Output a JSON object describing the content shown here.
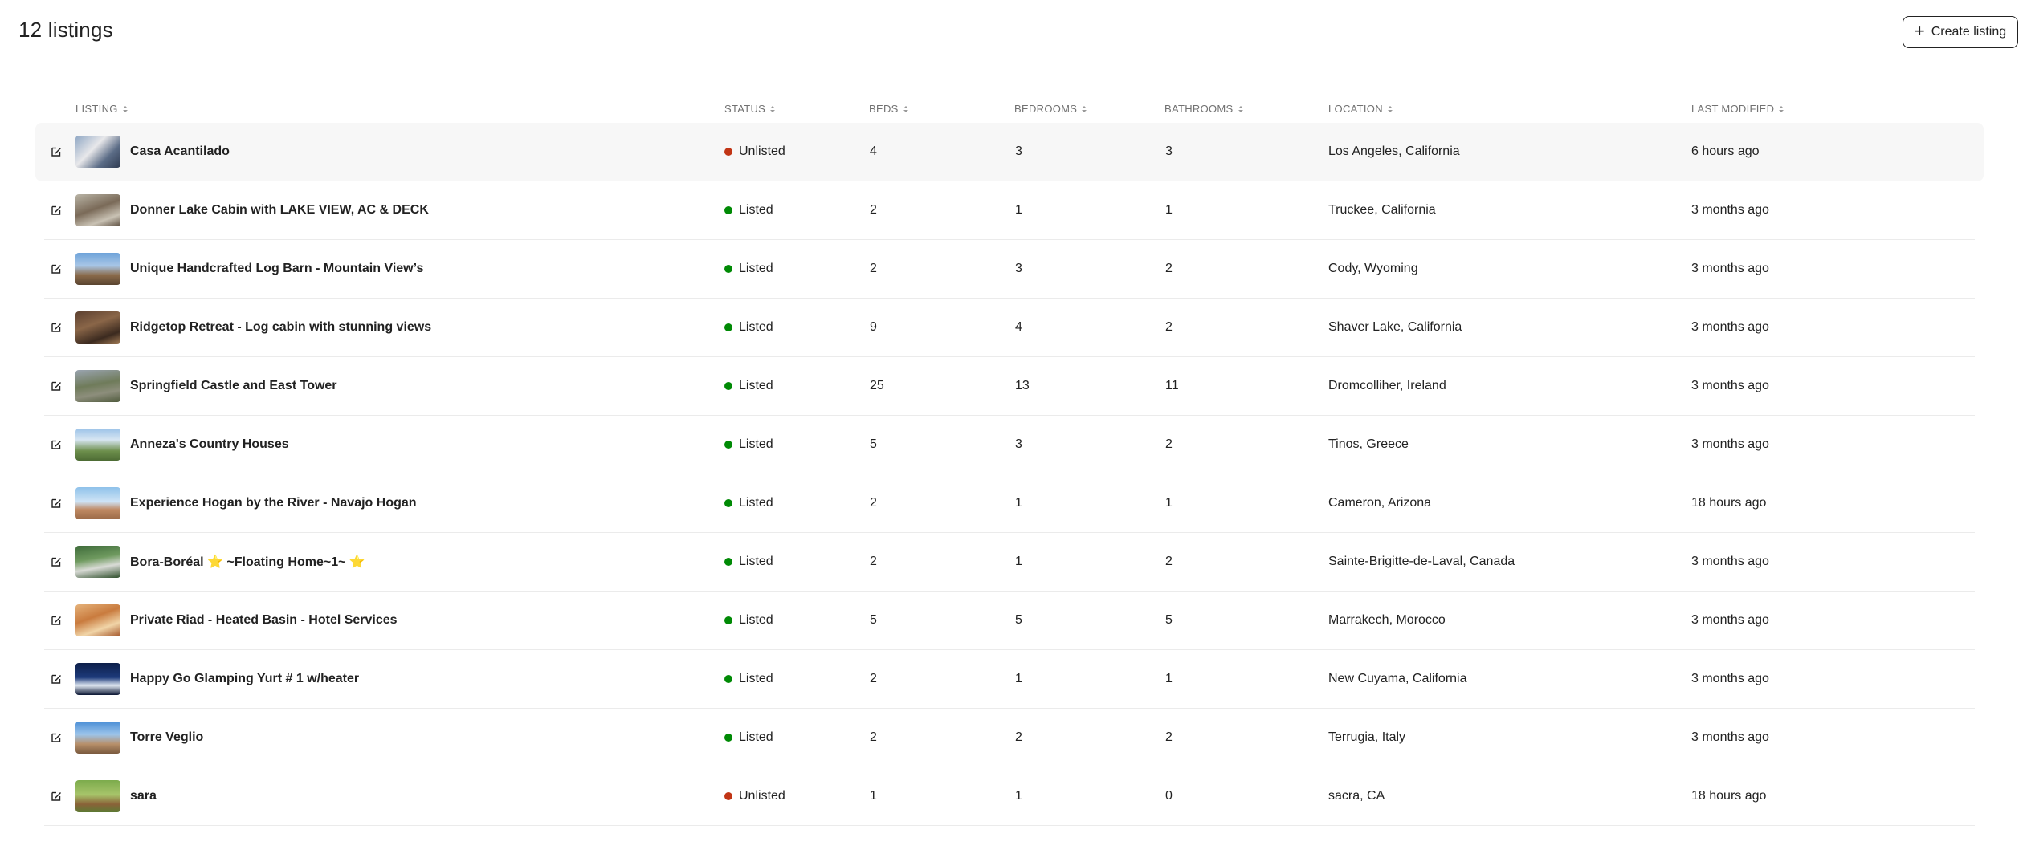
{
  "header": {
    "title": "12 listings",
    "create_label": "Create listing"
  },
  "columns": {
    "listing": "LISTING",
    "status": "STATUS",
    "beds": "BEDS",
    "bedrooms": "BEDROOMS",
    "bathrooms": "BATHROOMS",
    "location": "LOCATION",
    "last_modified": "LAST MODIFIED"
  },
  "colors": {
    "listed": "#008a05",
    "unlisted": "#c13515",
    "row_highlight": "#f7f7f7"
  },
  "listings": [
    {
      "name": "Casa Acantilado",
      "status": "Unlisted",
      "beds": "4",
      "bedrooms": "3",
      "bathrooms": "3",
      "location": "Los Angeles, California",
      "modified": "6 hours ago"
    },
    {
      "name": "Donner Lake Cabin with LAKE VIEW, AC & DECK",
      "status": "Listed",
      "beds": "2",
      "bedrooms": "1",
      "bathrooms": "1",
      "location": "Truckee, California",
      "modified": "3 months ago"
    },
    {
      "name": "Unique Handcrafted Log Barn - Mountain View’s",
      "status": "Listed",
      "beds": "2",
      "bedrooms": "3",
      "bathrooms": "2",
      "location": "Cody, Wyoming",
      "modified": "3 months ago"
    },
    {
      "name": "Ridgetop Retreat - Log cabin with stunning views",
      "status": "Listed",
      "beds": "9",
      "bedrooms": "4",
      "bathrooms": "2",
      "location": "Shaver Lake, California",
      "modified": "3 months ago"
    },
    {
      "name": "Springfield Castle and East Tower",
      "status": "Listed",
      "beds": "25",
      "bedrooms": "13",
      "bathrooms": "11",
      "location": "Dromcolliher, Ireland",
      "modified": "3 months ago"
    },
    {
      "name": "Anneza's Country Houses",
      "status": "Listed",
      "beds": "5",
      "bedrooms": "3",
      "bathrooms": "2",
      "location": "Tinos, Greece",
      "modified": "3 months ago"
    },
    {
      "name": "Experience Hogan by the River - Navajo Hogan",
      "status": "Listed",
      "beds": "2",
      "bedrooms": "1",
      "bathrooms": "1",
      "location": "Cameron, Arizona",
      "modified": "18 hours ago"
    },
    {
      "name": "Bora-Boréal ⭐ ~Floating Home~1~ ⭐",
      "status": "Listed",
      "beds": "2",
      "bedrooms": "1",
      "bathrooms": "2",
      "location": "Sainte-Brigitte-de-Laval, Canada",
      "modified": "3 months ago"
    },
    {
      "name": "Private Riad - Heated Basin - Hotel Services",
      "status": "Listed",
      "beds": "5",
      "bedrooms": "5",
      "bathrooms": "5",
      "location": "Marrakech, Morocco",
      "modified": "3 months ago"
    },
    {
      "name": "Happy Go Glamping Yurt # 1 w/heater",
      "status": "Listed",
      "beds": "2",
      "bedrooms": "1",
      "bathrooms": "1",
      "location": "New Cuyama, California",
      "modified": "3 months ago"
    },
    {
      "name": "Torre Veglio",
      "status": "Listed",
      "beds": "2",
      "bedrooms": "2",
      "bathrooms": "2",
      "location": "Terrugia, Italy",
      "modified": "3 months ago"
    },
    {
      "name": "sara",
      "status": "Unlisted",
      "beds": "1",
      "bedrooms": "1",
      "bathrooms": "0",
      "location": "sacra, CA",
      "modified": "18 hours ago"
    }
  ]
}
